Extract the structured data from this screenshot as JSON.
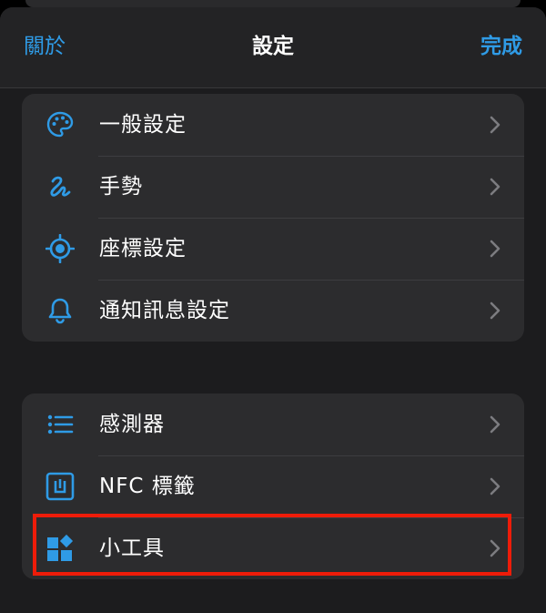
{
  "nav": {
    "left": "關於",
    "title": "設定",
    "right": "完成"
  },
  "group1": [
    {
      "label": "一般設定",
      "icon": "palette-icon"
    },
    {
      "label": "手勢",
      "icon": "gesture-squiggle-icon"
    },
    {
      "label": "座標設定",
      "icon": "location-target-icon"
    },
    {
      "label": "通知訊息設定",
      "icon": "bell-icon"
    }
  ],
  "group2": [
    {
      "label": "感測器",
      "icon": "list-icon"
    },
    {
      "label": "NFC 標籤",
      "icon": "nfc-tag-icon"
    },
    {
      "label": "小工具",
      "icon": "widgets-icon"
    }
  ],
  "colors": {
    "accent": "#2f9be6",
    "highlight": "#ee1c09",
    "background": "#1c1c1e",
    "cell": "#2c2c2e"
  }
}
